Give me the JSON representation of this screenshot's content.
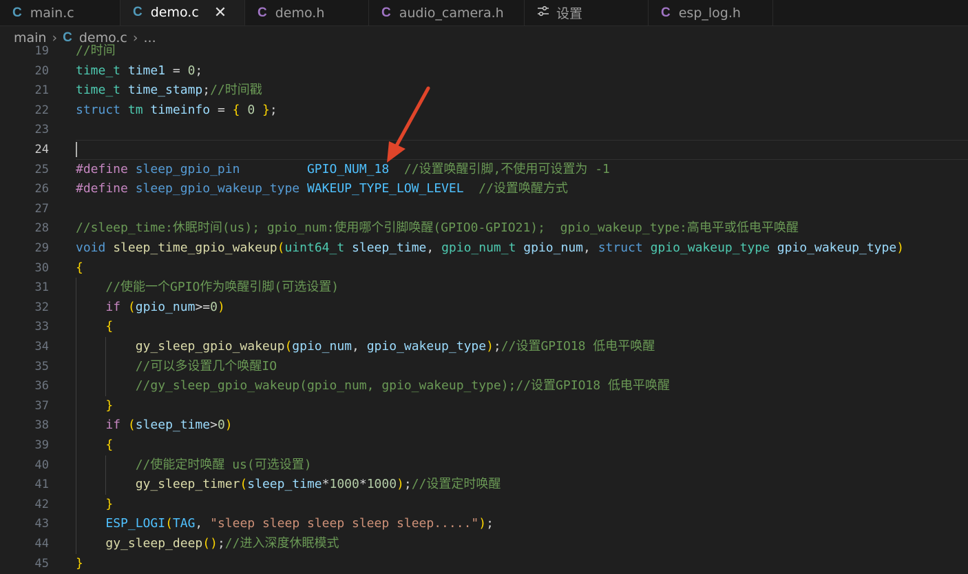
{
  "tabs": [
    {
      "icon": "C",
      "label": "main.c"
    },
    {
      "icon": "C",
      "label": "demo.c",
      "close": "✕"
    },
    {
      "icon": "C",
      "label": "demo.h"
    },
    {
      "icon": "C",
      "label": "audio_camera.h"
    },
    {
      "icon": "settings",
      "label": "设置"
    },
    {
      "icon": "C",
      "label": "esp_log.h"
    }
  ],
  "breadcrumb": {
    "folder": "main",
    "file_icon": "C",
    "file": "demo.c",
    "more": "..."
  },
  "editor": {
    "current_line": 24,
    "lines": [
      {
        "n": "19",
        "t": "//时间"
      },
      {
        "n": "20",
        "t": "time_t time1 = 0;"
      },
      {
        "n": "21",
        "t": "time_t time_stamp;//时间戳"
      },
      {
        "n": "22",
        "t": "struct tm timeinfo = { 0 };"
      },
      {
        "n": "23",
        "t": ""
      },
      {
        "n": "24",
        "t": ""
      },
      {
        "n": "25",
        "t": "#define sleep_gpio_pin         GPIO_NUM_18  //设置唤醒引脚,不使用可设置为 -1"
      },
      {
        "n": "26",
        "t": "#define sleep_gpio_wakeup_type WAKEUP_TYPE_LOW_LEVEL  //设置唤醒方式"
      },
      {
        "n": "27",
        "t": ""
      },
      {
        "n": "28",
        "t": "//sleep_time:休眠时间(us); gpio_num:使用哪个引脚唤醒(GPIO0-GPIO21);  gpio_wakeup_type:高电平或低电平唤醒"
      },
      {
        "n": "29",
        "t": "void sleep_time_gpio_wakeup(uint64_t sleep_time, gpio_num_t gpio_num, struct gpio_wakeup_type gpio_wakeup_type)"
      },
      {
        "n": "30",
        "t": "{"
      },
      {
        "n": "31",
        "t": "    //使能一个GPIO作为唤醒引脚(可选设置)"
      },
      {
        "n": "32",
        "t": "    if (gpio_num>=0)"
      },
      {
        "n": "33",
        "t": "    {"
      },
      {
        "n": "34",
        "t": "        gy_sleep_gpio_wakeup(gpio_num, gpio_wakeup_type);//设置GPIO18 低电平唤醒"
      },
      {
        "n": "35",
        "t": "        //可以多设置几个唤醒IO"
      },
      {
        "n": "36",
        "t": "        //gy_sleep_gpio_wakeup(gpio_num, gpio_wakeup_type);//设置GPIO18 低电平唤醒"
      },
      {
        "n": "37",
        "t": "    }"
      },
      {
        "n": "38",
        "t": "    if (sleep_time>0)"
      },
      {
        "n": "39",
        "t": "    {"
      },
      {
        "n": "40",
        "t": "        //使能定时唤醒 us(可选设置)"
      },
      {
        "n": "41",
        "t": "        gy_sleep_timer(sleep_time*1000*1000);//设置定时唤醒"
      },
      {
        "n": "42",
        "t": "    }"
      },
      {
        "n": "43",
        "t": "    ESP_LOGI(TAG, \"sleep sleep sleep sleep sleep.....\");"
      },
      {
        "n": "44",
        "t": "    gy_sleep_deep();//进入深度休眠模式"
      },
      {
        "n": "45",
        "t": "}"
      }
    ]
  },
  "colors": {
    "accent_c_icon": "#a074c4",
    "annotation_arrow": "#e0452a",
    "background": "#1f1f1f"
  }
}
